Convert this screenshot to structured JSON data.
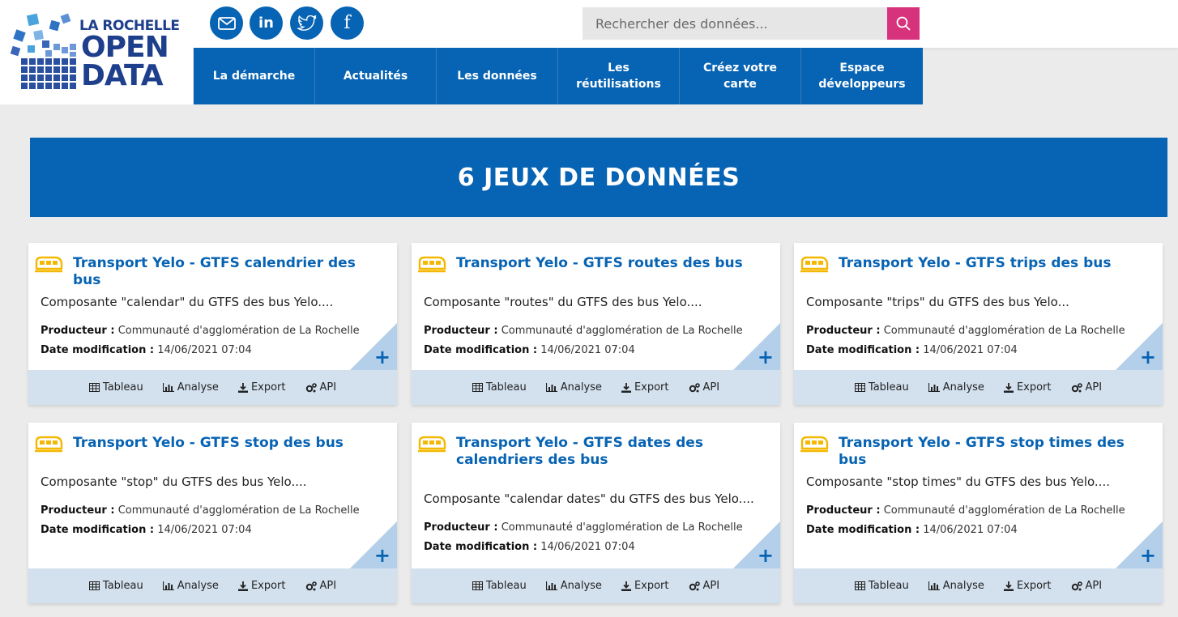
{
  "logo": {
    "line1": "LA ROCHELLE",
    "line2": "OPEN",
    "line3": "DATA"
  },
  "social": [
    {
      "icon": "mail-icon"
    },
    {
      "icon": "linkedin-icon",
      "text": "in"
    },
    {
      "icon": "twitter-icon"
    },
    {
      "icon": "facebook-icon",
      "text": "f"
    }
  ],
  "search": {
    "placeholder": "Rechercher des données...",
    "value": ""
  },
  "nav": [
    {
      "label": "La démarche"
    },
    {
      "label": "Actualités"
    },
    {
      "label": "Les données"
    },
    {
      "label": "Les réutilisations"
    },
    {
      "label": "Créez votre carte"
    },
    {
      "label": "Espace développeurs"
    }
  ],
  "banner": {
    "title": "6 JEUX DE DONNÉES"
  },
  "card_labels": {
    "producer": "Producteur :",
    "date": "Date modification :",
    "tableau": "Tableau",
    "analyse": "Analyse",
    "export": "Export",
    "api": "API",
    "plus": "+"
  },
  "cards": [
    {
      "title": "Transport Yelo - GTFS calendrier des bus",
      "description": "Composante \"calendar\" du GTFS des bus Yelo....",
      "producer": "Communauté d'agglomération de La Rochelle",
      "date": "14/06/2021 07:04"
    },
    {
      "title": "Transport Yelo - GTFS routes des bus",
      "description": "Composante \"routes\" du GTFS des bus Yelo....",
      "producer": "Communauté d'agglomération de La Rochelle",
      "date": "14/06/2021 07:04"
    },
    {
      "title": "Transport Yelo - GTFS trips des bus",
      "description": "Composante \"trips\" du GTFS des bus Yelo...",
      "producer": "Communauté d'agglomération de La Rochelle",
      "date": "14/06/2021 07:04"
    },
    {
      "title": "Transport Yelo - GTFS stop des bus",
      "description": "Composante \"stop\" du GTFS des bus Yelo....",
      "producer": "Communauté d'agglomération de La Rochelle",
      "date": "14/06/2021 07:04"
    },
    {
      "title": "Transport Yelo - GTFS dates des calendriers des bus",
      "description": "Composante \"calendar dates\" du GTFS des bus Yelo....",
      "producer": "Communauté d'agglomération de La Rochelle",
      "date": "14/06/2021 07:04"
    },
    {
      "title": "Transport Yelo - GTFS stop times des bus",
      "description": "Composante \"stop times\" du GTFS des bus Yelo....",
      "producer": "Communauté d'agglomération de La Rochelle",
      "date": "14/06/2021 07:04"
    }
  ],
  "colors": {
    "primary": "#0763b3",
    "search_button": "#d7337d",
    "card_footer": "#d3e1ef",
    "bus_icon": "#f5b800",
    "corner": "#b4cfe9"
  }
}
